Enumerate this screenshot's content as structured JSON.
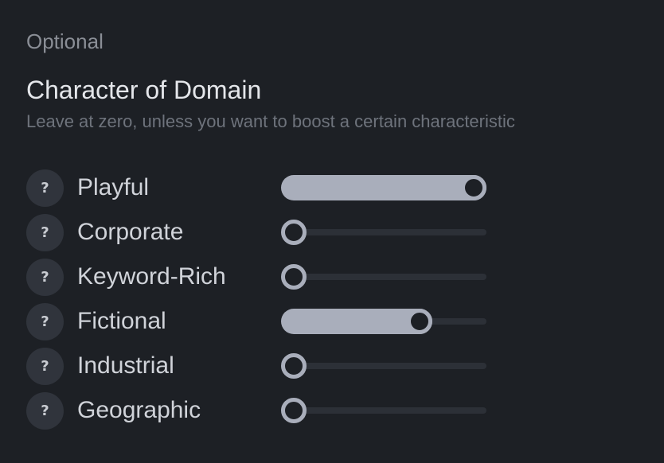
{
  "section": {
    "label": "Optional",
    "title": "Character of Domain",
    "description": "Leave at zero, unless you want to boost a certain characteristic"
  },
  "help_glyph": "?",
  "colors": {
    "background": "#1d2025",
    "track": "#2c3037",
    "fill": "#a9aebb",
    "help_button": "#30343c"
  },
  "characteristics": [
    {
      "label": "Playful",
      "value": 1.0
    },
    {
      "label": "Corporate",
      "value": 0.0
    },
    {
      "label": "Keyword-Rich",
      "value": 0.0
    },
    {
      "label": "Fictional",
      "value": 0.7
    },
    {
      "label": "Industrial",
      "value": 0.0
    },
    {
      "label": "Geographic",
      "value": 0.0
    }
  ]
}
